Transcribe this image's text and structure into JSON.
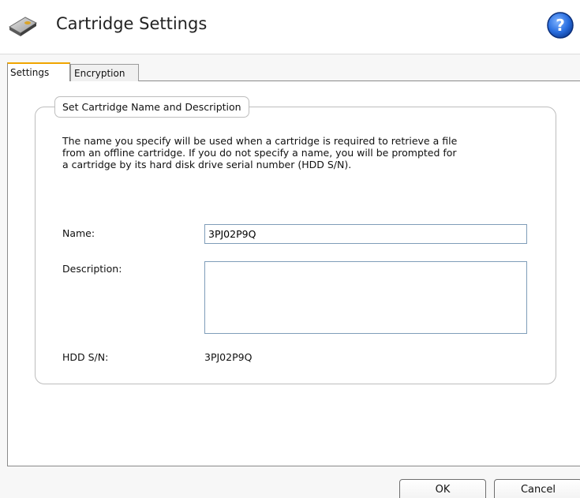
{
  "window": {
    "title": "Cartridge Settings"
  },
  "tabs": [
    {
      "label": "Settings",
      "active": true
    },
    {
      "label": "Encryption",
      "active": false
    }
  ],
  "group": {
    "legend": "Set Cartridge Name and Description",
    "description_line1": "The name you specify will be used when a cartridge is required to retrieve a file",
    "description_line2": "from an offline cartridge. If you do not specify a name, you will be prompted for",
    "description_line3": "a cartridge by its hard disk drive serial number (HDD S/N).",
    "name_label": "Name:",
    "name_value": "3PJ02P9Q",
    "description_label": "Description:",
    "description_value": "",
    "hdd_label": "HDD S/N:",
    "hdd_value": "3PJ02P9Q"
  },
  "buttons": {
    "ok": "OK",
    "cancel": "Cancel"
  },
  "icons": {
    "app": "cartridge-drive-icon",
    "help": "help-question-icon"
  },
  "colors": {
    "active_tab_accent": "#f0a500",
    "help_blue": "#1c5fcf"
  }
}
